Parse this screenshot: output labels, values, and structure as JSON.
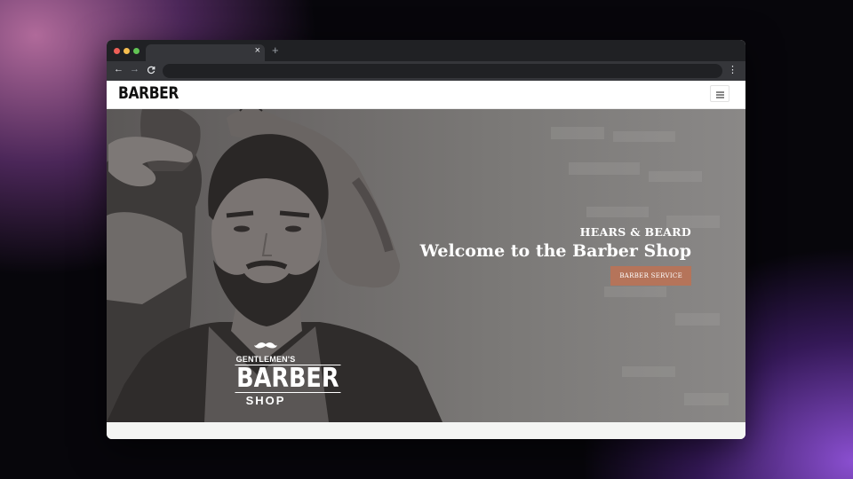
{
  "browser": {
    "tab_close": "×",
    "new_tab": "+",
    "back": "←",
    "forward": "→",
    "reload": "C",
    "menu": "⋮"
  },
  "site": {
    "logo": "BARBER",
    "menu_icon": "hamburger-menu-icon"
  },
  "hero": {
    "subtitle": "HEARS & BEARD",
    "title": "Welcome to the Barber Shop",
    "button": "BARBER SERVICE",
    "accent_color": "#b5745a"
  },
  "badge": {
    "top": "GENTLEMEN'S",
    "main": "BARBER",
    "bottom": "SHOP"
  }
}
